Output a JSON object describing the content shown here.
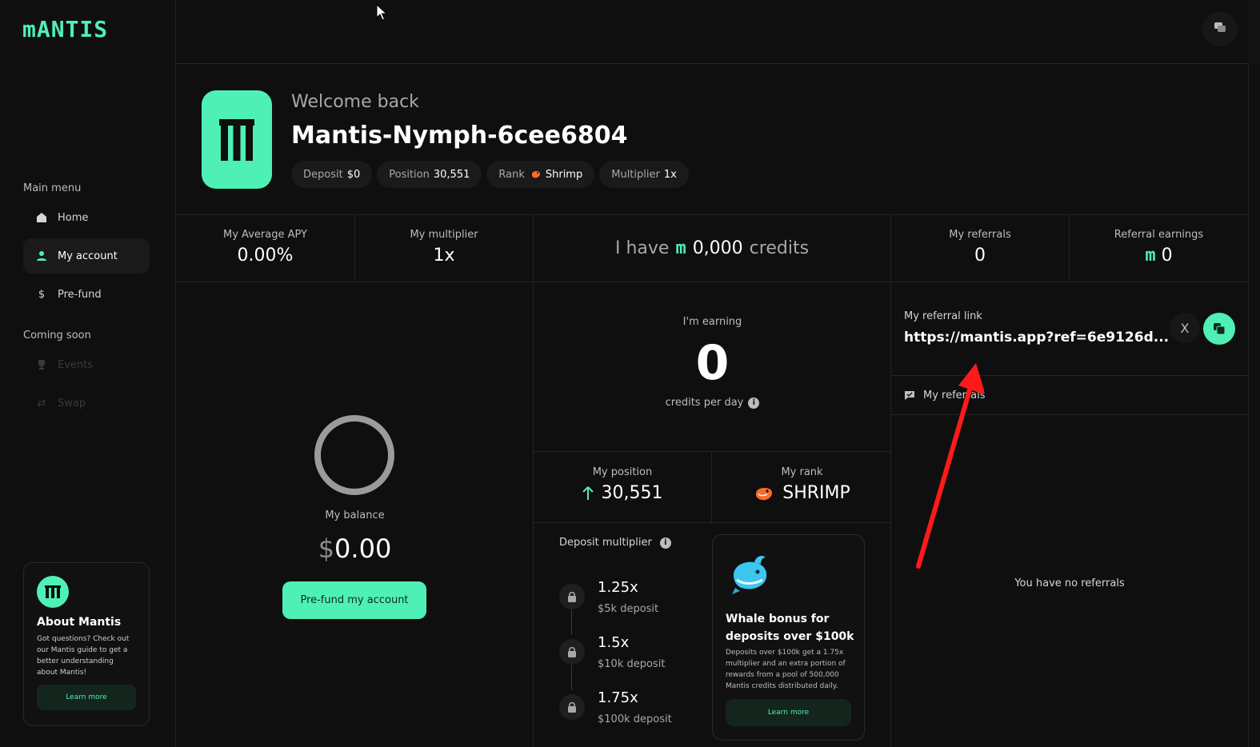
{
  "app": {
    "logo": "mANTIS"
  },
  "sidebar": {
    "main_menu_label": "Main menu",
    "items": [
      {
        "label": "Home",
        "icon": "home-icon"
      },
      {
        "label": "My account",
        "icon": "user-icon"
      },
      {
        "label": "Pre-fund",
        "icon": "dollar-icon"
      }
    ],
    "coming_soon_label": "Coming soon",
    "soon_items": [
      {
        "label": "Events",
        "icon": "trophy-icon"
      },
      {
        "label": "Swap",
        "icon": "swap-icon"
      }
    ],
    "about": {
      "title": "About Mantis",
      "text": "Got questions? Check out our Mantis guide to get a better understanding about Mantis!",
      "button": "Learn more"
    }
  },
  "profile": {
    "welcome": "Welcome back",
    "username": "Mantis-Nymph-6cee6804",
    "chips": [
      {
        "label": "Deposit",
        "value": "$0"
      },
      {
        "label": "Position",
        "value": "30,551"
      },
      {
        "label": "Rank",
        "value": "Shrimp"
      },
      {
        "label": "Multiplier",
        "value": "1x"
      }
    ]
  },
  "stats": {
    "apy_label": "My Average APY",
    "apy_value": "0.00%",
    "multiplier_label": "My multiplier",
    "multiplier_value": "1x",
    "credits_prefix": "I have",
    "credits_value": "0,000",
    "credits_suffix": "credits",
    "referrals_label": "My referrals",
    "referrals_value": "0",
    "ref_earnings_label": "Referral earnings",
    "ref_earnings_value": "0"
  },
  "balance": {
    "label": "My balance",
    "currency": "$",
    "value": "0.00",
    "button": "Pre-fund my account"
  },
  "earning": {
    "label": "I'm earning",
    "value": "0",
    "unit": "credits per day"
  },
  "position": {
    "label": "My position",
    "value": "30,551"
  },
  "rank": {
    "label": "My rank",
    "value": "SHRIMP"
  },
  "deposit_multiplier": {
    "title": "Deposit multiplier",
    "tiers": [
      {
        "mult": "1.25x",
        "desc": "$5k deposit"
      },
      {
        "mult": "1.5x",
        "desc": "$10k deposit"
      },
      {
        "mult": "1.75x",
        "desc": "$100k deposit"
      }
    ]
  },
  "whale": {
    "title": "Whale bonus for deposits over $100k",
    "text": "Deposits over $100k get a 1.75x multiplier and an extra portion of rewards from a pool of 500,000 Mantis credits distributed daily.",
    "button": "Learn more"
  },
  "referral": {
    "link_label": "My referral link",
    "link_value": "https://mantis.app?ref=6e9126d...",
    "x_icon": "X",
    "tab_label": "My referrals",
    "empty_text": "You have no referrals"
  },
  "colors": {
    "accent": "#4ef0b5",
    "background": "#0f0f0f",
    "annotation": "#ff1a1a"
  }
}
